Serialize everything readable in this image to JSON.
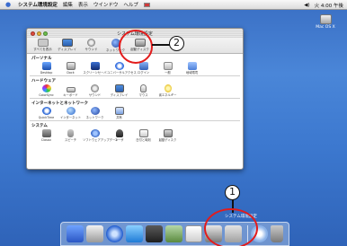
{
  "menubar": {
    "app_name": "システム環境設定",
    "items": [
      "編集",
      "表示",
      "ウインドウ",
      "ヘルプ"
    ],
    "status": "火 4:00 午後"
  },
  "desktop": {
    "hd_label": "Mac OS X"
  },
  "window": {
    "title": "システム環境設定",
    "toolbar": [
      "すべてを表示",
      "ディスプレイ",
      "サウンド",
      "ネットワーク",
      "起動ディスク"
    ],
    "sections": [
      {
        "title": "パーソナル",
        "items": [
          "Desktop",
          "Dock",
          "スクリーンセーバ",
          "ユニバーサルアクセス",
          "ログイン",
          "一般",
          "地域環境"
        ]
      },
      {
        "title": "ハードウェア",
        "items": [
          "ColorSync",
          "キーボード",
          "サウンド",
          "ディスプレイ",
          "マウス",
          "省エネルギー"
        ]
      },
      {
        "title": "インターネットとネットワーク",
        "items": [
          "QuickTime",
          "インターネット",
          "ネットワーク",
          "共有"
        ]
      },
      {
        "title": "システム",
        "items": [
          "Classic",
          "スピーチ",
          "ソフトウェアアップデート",
          "ユーザ",
          "日付と時刻",
          "起動ディスク"
        ]
      }
    ]
  },
  "callouts": {
    "one": "1",
    "two": "2"
  },
  "dock": {
    "label": "システム環境設定"
  }
}
